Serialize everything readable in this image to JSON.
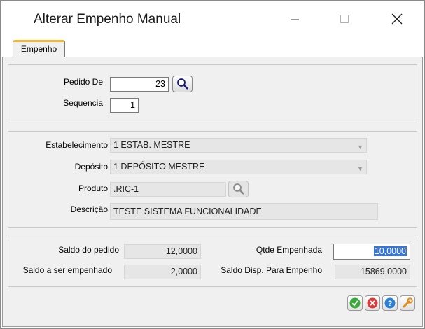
{
  "window": {
    "title": "Alterar Empenho Manual"
  },
  "tabs": [
    {
      "label": "Empenho"
    }
  ],
  "pedido": {
    "pedido_de_label": "Pedido De",
    "pedido_de_value": "23",
    "sequencia_label": "Sequencia",
    "sequencia_value": "1"
  },
  "item": {
    "estabelecimento_label": "Estabelecimento",
    "estabelecimento_value": "1 ESTAB. MESTRE",
    "deposito_label": "Depósito",
    "deposito_value": "1 DEPÓSITO MESTRE",
    "produto_label": "Produto",
    "produto_value": ".RIC-1",
    "descricao_label": "Descrição",
    "descricao_value": "TESTE SISTEMA FUNCIONALIDADE"
  },
  "saldos": {
    "saldo_pedido_label": "Saldo do pedido",
    "saldo_pedido_value": "12,0000",
    "saldo_empenhar_label": "Saldo a ser empenhado",
    "saldo_empenhar_value": "2,0000",
    "qtde_empenhada_label": "Qtde Empenhada",
    "qtde_empenhada_value": "10,0000",
    "saldo_disp_label": "Saldo Disp. Para Empenho",
    "saldo_disp_value": "15869,0000"
  },
  "colors": {
    "tab_accent": "#f2b632",
    "ok": "#3aa83a",
    "cancel": "#d93a3a",
    "help": "#2a7fd4",
    "tools": "#e08a1a"
  },
  "icons": [
    "search-icon",
    "minimize-icon",
    "maximize-icon",
    "close-icon",
    "ok-icon",
    "cancel-icon",
    "help-icon",
    "wrench-icon"
  ]
}
